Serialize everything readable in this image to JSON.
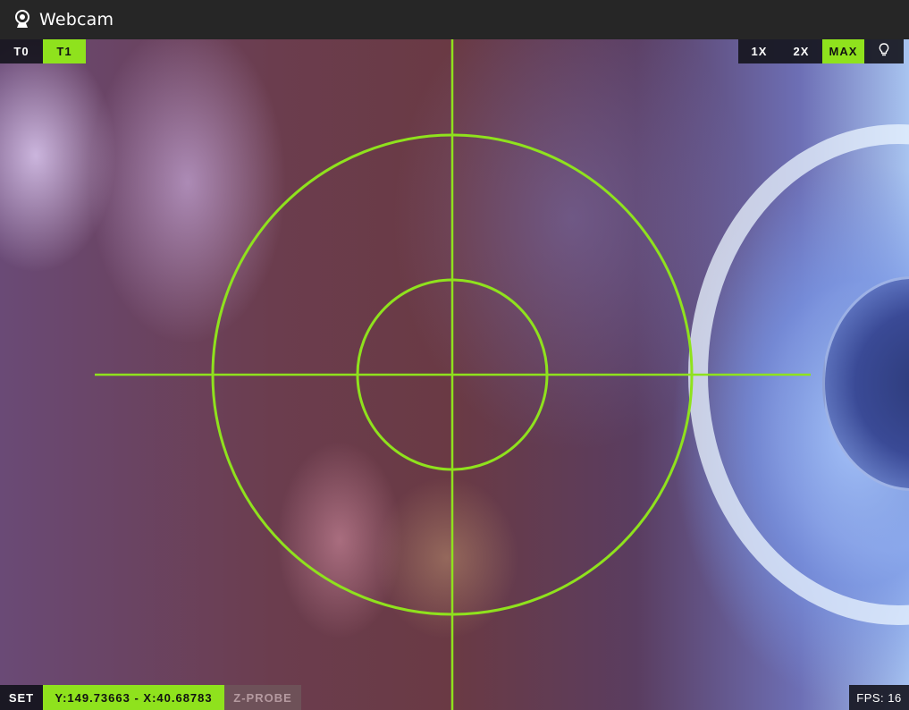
{
  "window": {
    "title": "Webcam",
    "icon": "webcam-icon"
  },
  "tools": [
    {
      "label": "T0",
      "active": false
    },
    {
      "label": "T1",
      "active": true
    }
  ],
  "zoom": [
    {
      "label": "1X",
      "active": false
    },
    {
      "label": "2X",
      "active": false
    },
    {
      "label": "MAX",
      "active": true
    }
  ],
  "light_button": {
    "icon": "lightbulb-icon"
  },
  "bottom": {
    "set_label": "SET",
    "coordinates": "Y:149.73663 - X:40.68783",
    "zprobe_label": "Z-PROBE"
  },
  "status": {
    "fps_label": "FPS: 16"
  },
  "colors": {
    "accent": "#8fe21d",
    "titlebar": "#262626"
  }
}
